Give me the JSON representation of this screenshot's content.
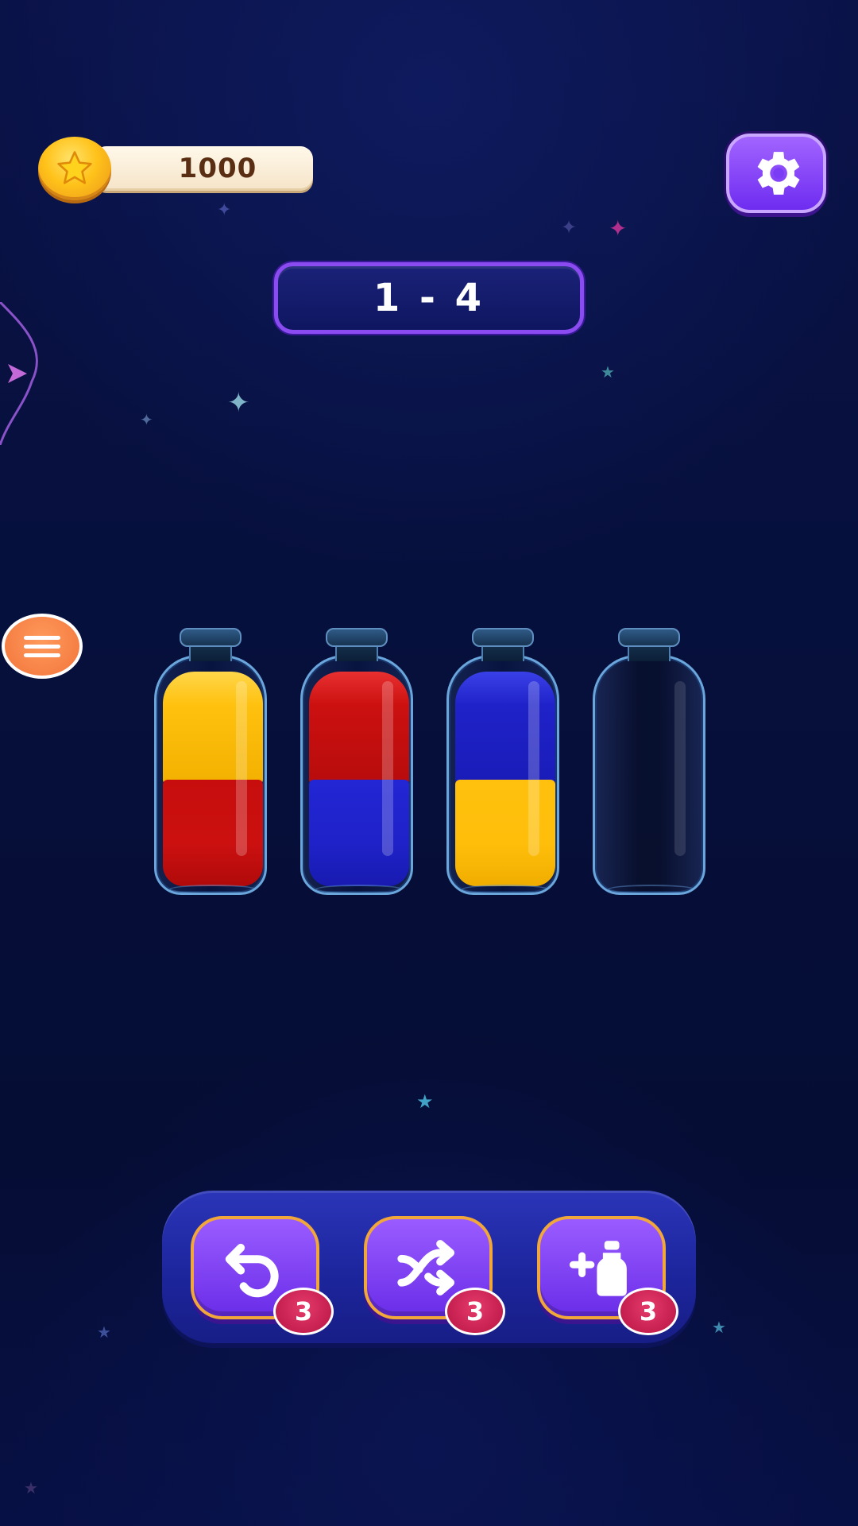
{
  "hud": {
    "coins": "1000",
    "coin_icon": "star-coin-icon",
    "settings_icon": "gear-icon"
  },
  "level": {
    "label": "1 - 4"
  },
  "menu": {
    "icon": "hamburger-menu-icon"
  },
  "bottles": [
    {
      "layers_top_to_bottom": [
        "yellow",
        "red"
      ]
    },
    {
      "layers_top_to_bottom": [
        "red",
        "blue"
      ]
    },
    {
      "layers_top_to_bottom": [
        "blue",
        "yellow"
      ]
    },
    {
      "layers_top_to_bottom": []
    }
  ],
  "colors": {
    "yellow": "#ffc10e",
    "red": "#cc1010",
    "blue": "#1f22c8",
    "accent_purple": "#7a3cf4",
    "badge_red": "#c81a4e"
  },
  "powerups": [
    {
      "name": "undo",
      "icon": "undo-icon",
      "count": "3"
    },
    {
      "name": "shuffle",
      "icon": "shuffle-icon",
      "count": "3"
    },
    {
      "name": "add-bottle",
      "icon": "add-bottle-icon",
      "count": "3"
    }
  ]
}
